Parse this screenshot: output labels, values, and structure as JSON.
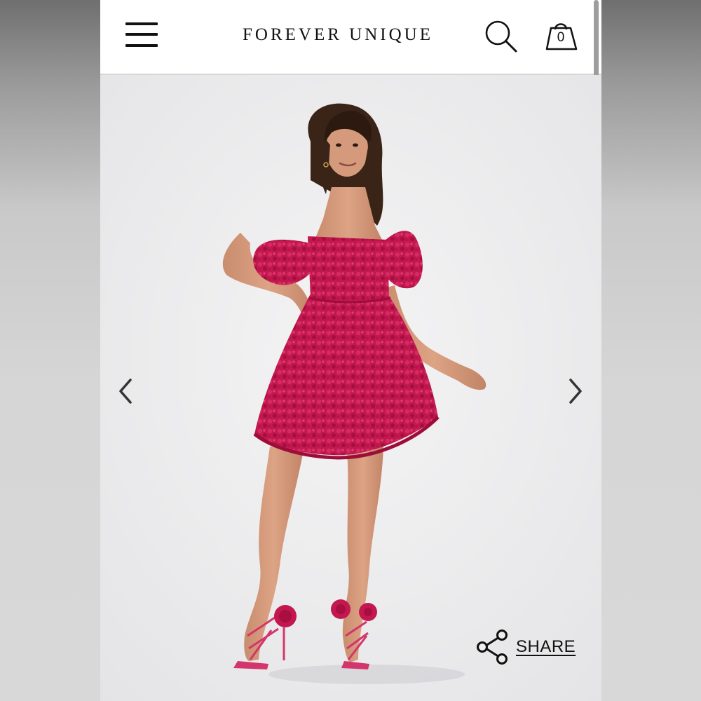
{
  "header": {
    "brand": "FOREVER UNIQUE",
    "menu_icon": "hamburger-menu-icon",
    "search_icon": "search-icon",
    "bag_icon": "shopping-bag-icon",
    "bag_count": "0"
  },
  "gallery": {
    "image_subject": "model-in-pink-floral-mini-dress",
    "prev_icon": "chevron-left-icon",
    "next_icon": "chevron-right-icon"
  },
  "share": {
    "icon": "share-icon",
    "label": "SHARE"
  },
  "colors": {
    "dress": "#c2184f",
    "background": "#eeeeef",
    "text": "#111111"
  }
}
